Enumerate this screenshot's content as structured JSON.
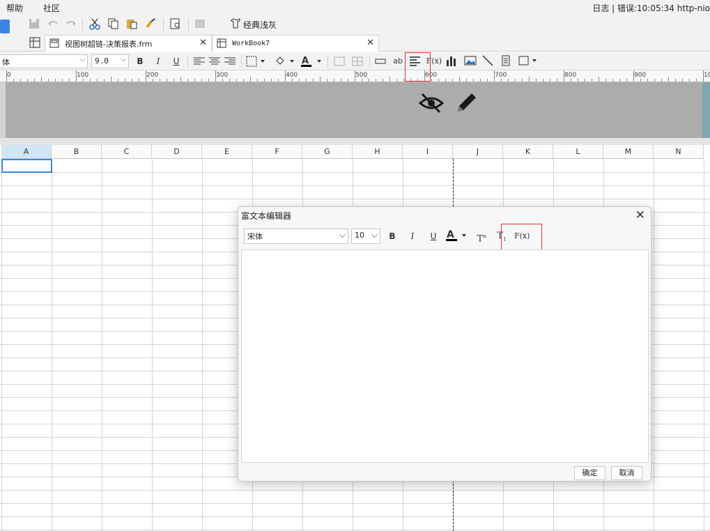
{
  "menubar": {
    "items": [
      "帮助",
      "社区"
    ],
    "status": "日志 | 错误:10:05:34 http-nio"
  },
  "toolbar": {
    "style_label": "经典浅灰"
  },
  "tabs": [
    {
      "label": "视图树超链-决策报表.frm"
    },
    {
      "label": "WorkBook7"
    }
  ],
  "format_bar": {
    "font": "体",
    "size": "9.0",
    "bold": "B",
    "italic": "I",
    "underline": "U",
    "text_tool": "ab",
    "formula": "F(x)"
  },
  "ruler": {
    "ticks": [
      "0",
      "100",
      "200",
      "300",
      "400",
      "500",
      "600",
      "700",
      "800",
      "900",
      "10"
    ]
  },
  "grid": {
    "columns": [
      "A",
      "B",
      "C",
      "D",
      "E",
      "F",
      "G",
      "H",
      "I",
      "J",
      "K",
      "L",
      "M",
      "N"
    ]
  },
  "dialog": {
    "title": "富文本编辑器",
    "font": "宋体",
    "size": "10",
    "bold": "B",
    "italic": "I",
    "underline": "U",
    "superscript": "T",
    "subscript": "T",
    "formula": "F(x)",
    "ok_label": "确定",
    "cancel_label": "取消"
  },
  "colors": {
    "header_area": "#acacac",
    "selection": "#3c84e3",
    "highlight": "#e03030"
  }
}
